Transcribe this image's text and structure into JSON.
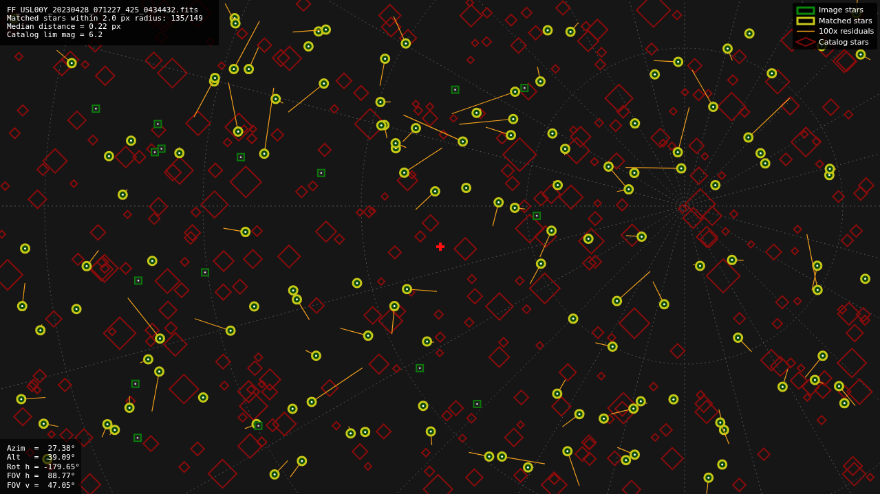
{
  "info": {
    "lines": [
      "FF_USL00Y_20230428_071227_425_0434432.fits",
      "Matched stars within 2.0 px radius: 135/149",
      "Median distance = 0.22 px",
      "Catalog lim mag = 6.2"
    ]
  },
  "legend": [
    {
      "kind": "image",
      "label": "Image stars"
    },
    {
      "kind": "matched",
      "label": "Matched stars"
    },
    {
      "kind": "residual",
      "label": "100x residuals"
    },
    {
      "kind": "catalog",
      "label": "Catalog stars"
    }
  ],
  "pointing": {
    "lines": [
      "Azim  =  27.38°",
      "Alt   =  39.09°",
      "Rot h = -179.65°",
      "FOV h =  88.77°",
      "FOV v =  47.05°"
    ]
  }
}
